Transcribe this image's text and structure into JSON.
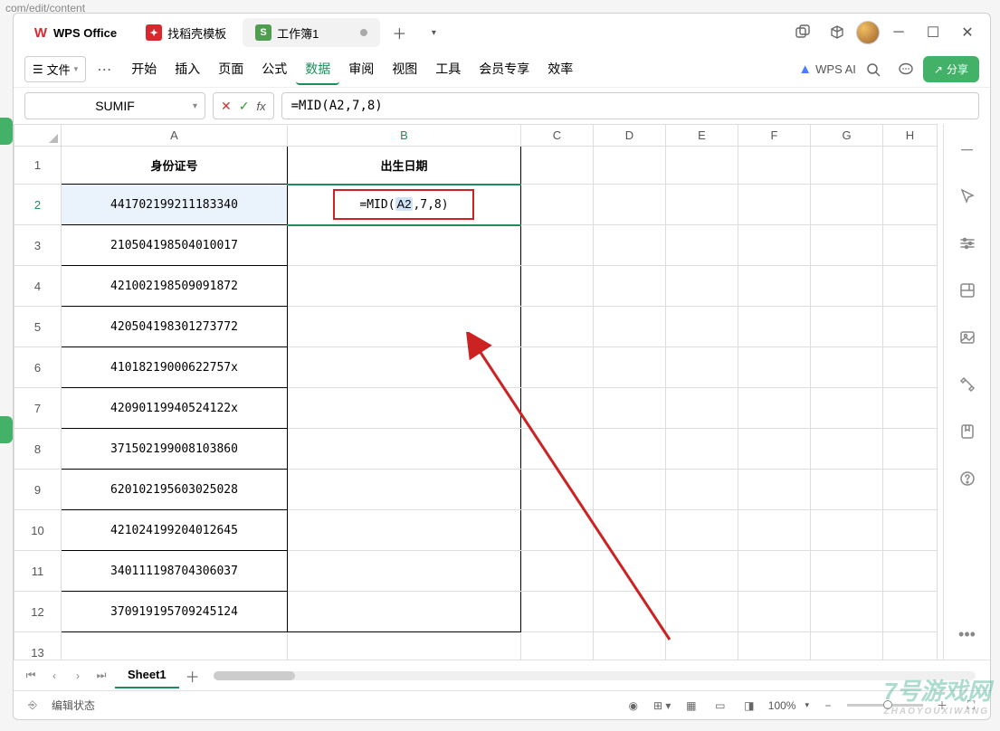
{
  "url_fragment": "com/edit/content",
  "tabs": {
    "wps": "WPS Office",
    "template": "找稻壳模板",
    "sheet": "工作簿1"
  },
  "file_menu": "文件",
  "menu": [
    "开始",
    "插入",
    "页面",
    "公式",
    "数据",
    "审阅",
    "视图",
    "工具",
    "会员专享",
    "效率"
  ],
  "active_menu_idx": 4,
  "ai_label": "WPS AI",
  "share_label": "分享",
  "name_box": "SUMIF",
  "formula": "=MID(A2,7,8)",
  "b2_display": {
    "prefix": "=MID(",
    "ref": "A2",
    "mid": ",7,8)",
    "suffix": ""
  },
  "columns": [
    "A",
    "B",
    "C",
    "D",
    "E",
    "F",
    "G",
    "H"
  ],
  "rows": [
    1,
    2,
    3,
    4,
    5,
    6,
    7,
    8,
    9,
    10,
    11,
    12,
    13
  ],
  "header_row": {
    "A": "身份证号",
    "B": "出生日期"
  },
  "data_A": [
    "441702199211183340",
    "210504198504010017",
    "421002198509091872",
    "420504198301273772",
    "41018219000622757x",
    "42090119940524122x",
    "371502199008103860",
    "620102195603025028",
    "421024199204012645",
    "340111198704306037",
    "370919195709245124"
  ],
  "sheet_tab": "Sheet1",
  "status": "编辑状态",
  "zoom": "100%",
  "watermark": {
    "big": "7号游戏网",
    "small": "ZHAOYOUXIWANG"
  }
}
